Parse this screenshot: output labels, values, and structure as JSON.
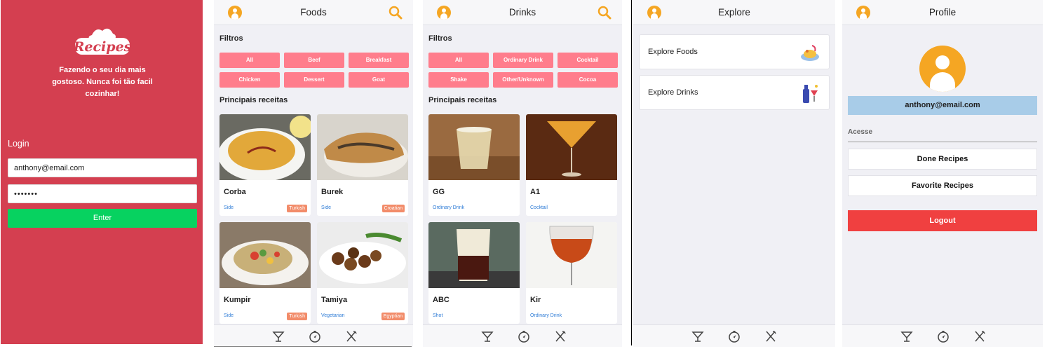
{
  "login": {
    "logo_text": "Recipes",
    "slogan": "Fazendo o seu dia mais gostoso. Nunca foi tão facil cozinhar!",
    "label": "Login",
    "email_value": "anthony@email.com",
    "password_value": "•••••••",
    "enter_label": "Enter",
    "colors": {
      "background": "#d43f50",
      "enter": "#07d260"
    }
  },
  "foods": {
    "title": "Foods",
    "filters_heading": "Filtros",
    "filters": [
      "All",
      "Beef",
      "Breakfast",
      "Chicken",
      "Dessert",
      "Goat"
    ],
    "main_heading": "Principais receitas",
    "cards": [
      {
        "name": "Corba",
        "category": "Side",
        "area": "Turkish"
      },
      {
        "name": "Burek",
        "category": "Side",
        "area": "Croatian"
      },
      {
        "name": "Kumpir",
        "category": "Side",
        "area": "Turkish"
      },
      {
        "name": "Tamiya",
        "category": "Vegetarian",
        "area": "Egyptian"
      }
    ]
  },
  "drinks": {
    "title": "Drinks",
    "filters_heading": "Filtros",
    "filters": [
      "All",
      "Ordinary Drink",
      "Cocktail",
      "Shake",
      "Other/Unknown",
      "Cocoa"
    ],
    "main_heading": "Principais receitas",
    "cards": [
      {
        "name": "GG",
        "category": "Ordinary Drink"
      },
      {
        "name": "A1",
        "category": "Cocktail"
      },
      {
        "name": "ABC",
        "category": "Shot"
      },
      {
        "name": "Kir",
        "category": "Ordinary Drink"
      }
    ]
  },
  "explore": {
    "title": "Explore",
    "items": [
      {
        "label": "Explore Foods",
        "icon": "food-plate-icon"
      },
      {
        "label": "Explore Drinks",
        "icon": "drink-bottles-icon"
      }
    ]
  },
  "profile": {
    "title": "Profile",
    "email": "anthony@email.com",
    "access_label": "Acesse",
    "done_recipes": "Done Recipes",
    "favorite_recipes": "Favorite Recipes",
    "logout": "Logout",
    "colors": {
      "email_bg": "#a8cce8",
      "logout": "#f04040",
      "accent": "#f5a623",
      "chip": "#ff7d8c"
    }
  },
  "footer_icons": [
    "drink-icon",
    "explore-compass-icon",
    "food-utensils-icon"
  ]
}
